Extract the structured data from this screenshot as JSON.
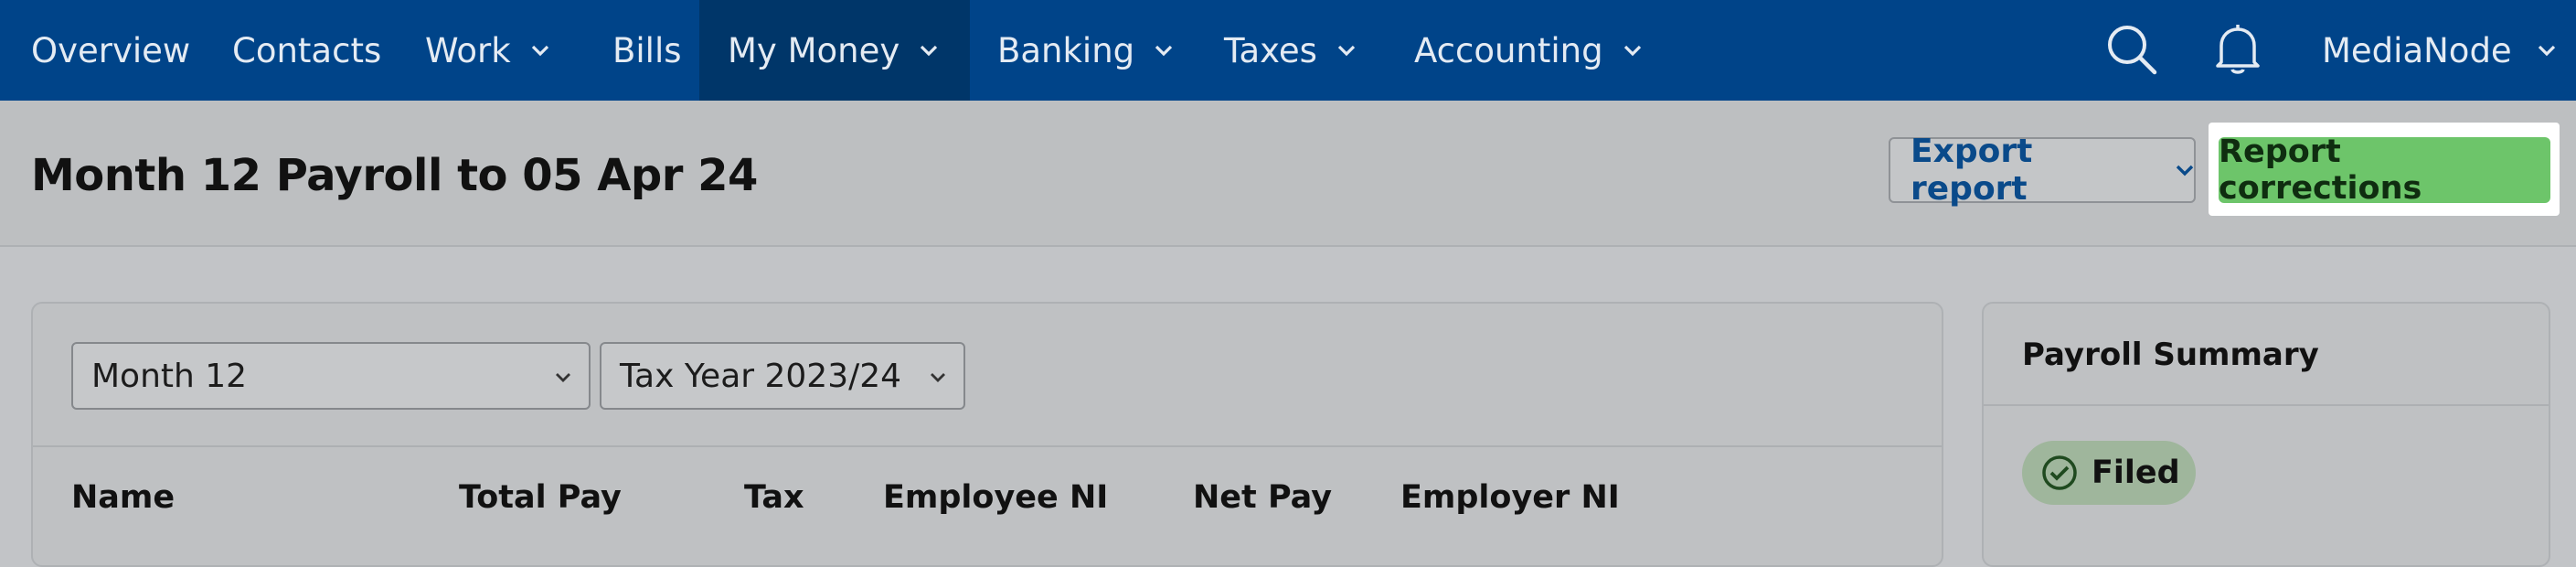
{
  "nav": {
    "items": [
      {
        "label": "Overview",
        "dropdown": false
      },
      {
        "label": "Contacts",
        "dropdown": false
      },
      {
        "label": "Work",
        "dropdown": true
      },
      {
        "label": "Bills",
        "dropdown": false
      },
      {
        "label": "My Money",
        "dropdown": true,
        "active": true
      },
      {
        "label": "Banking",
        "dropdown": true
      },
      {
        "label": "Taxes",
        "dropdown": true
      },
      {
        "label": "Accounting",
        "dropdown": true
      }
    ],
    "search_icon": "search-icon",
    "notifications_icon": "bell-icon",
    "account": {
      "label": "MediaNode"
    }
  },
  "header": {
    "title": "Month 12 Payroll to 05 Apr 24",
    "export_label": "Export report",
    "report_corrections_label": "Report corrections"
  },
  "filters": {
    "period": "Month 12",
    "tax_year": "Tax Year 2023/24"
  },
  "table": {
    "columns": [
      "Name",
      "Total Pay",
      "Tax",
      "Employee NI",
      "Net Pay",
      "Employer NI"
    ]
  },
  "summary": {
    "title": "Payroll Summary",
    "status": "Filed"
  },
  "colors": {
    "nav_bg": "#004489",
    "nav_active": "#003669",
    "primary_button": "#6dc56a",
    "link": "#0a4a8a",
    "status_filed": "#9fb69c"
  }
}
